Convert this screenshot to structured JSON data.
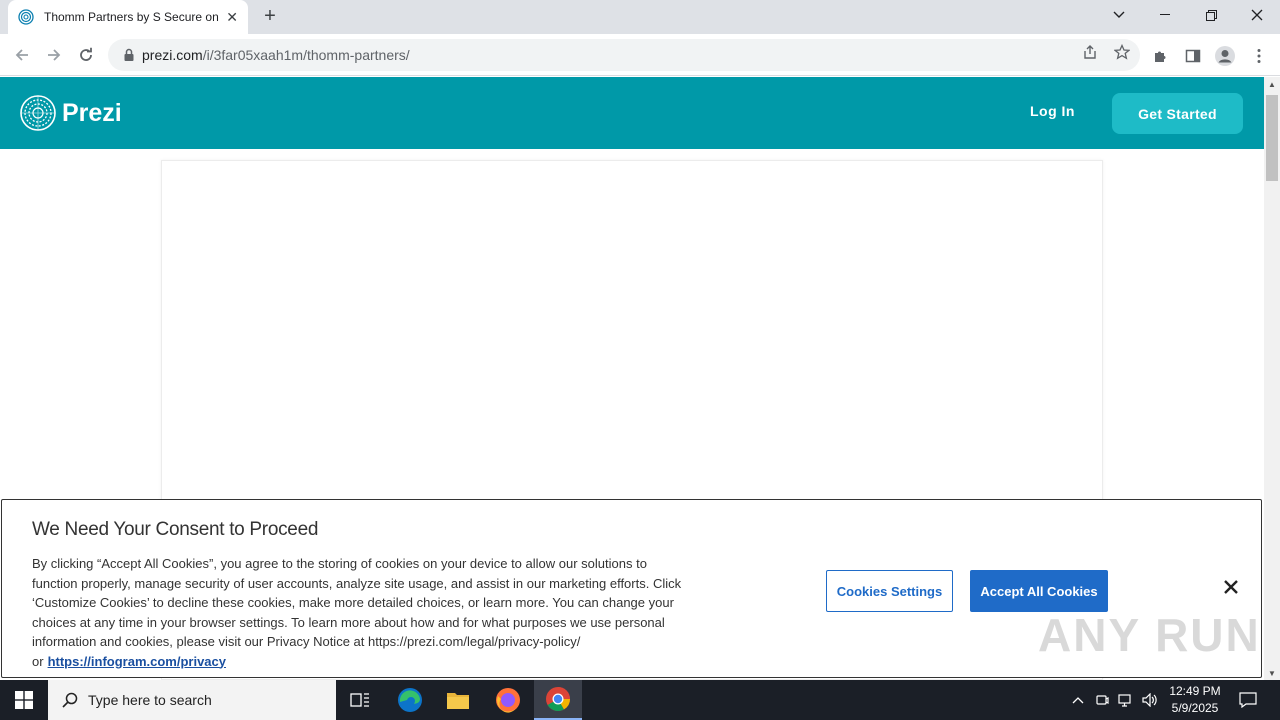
{
  "browser": {
    "tab_title": "Thomm Partners by S Secure on",
    "url_host": "prezi.com",
    "url_path": "/i/3far05xaah1m/thomm-partners/"
  },
  "header": {
    "brand": "Prezi",
    "login": "Log In",
    "get_started": "Get Started"
  },
  "consent": {
    "title": "We Need Your Consent to Proceed",
    "body": "By clicking “Accept All Cookies”, you agree to the storing of cookies on your device to allow our solutions to function properly, manage security of user accounts, analyze site usage, and assist in our marketing efforts. Click ‘Customize Cookies’ to decline these cookies, make more detailed choices, or learn more. You can change your choices at any time in your browser settings. To learn more about how and for what purposes we use personal information and cookies, please visit our Privacy Notice at https://prezi.com/legal/privacy-policy/ or",
    "link": "https://infogram.com/privacy",
    "settings_button": "Cookies Settings",
    "accept_button": "Accept All Cookies"
  },
  "watermark": "ANY RUN",
  "taskbar": {
    "search_placeholder": "Type here to search",
    "time": "12:49 PM",
    "date": "5/9/2025"
  },
  "colors": {
    "prezi_teal": "#0099a8",
    "get_started_bg": "#1ebbc7",
    "consent_blue": "#1f6bc8"
  }
}
